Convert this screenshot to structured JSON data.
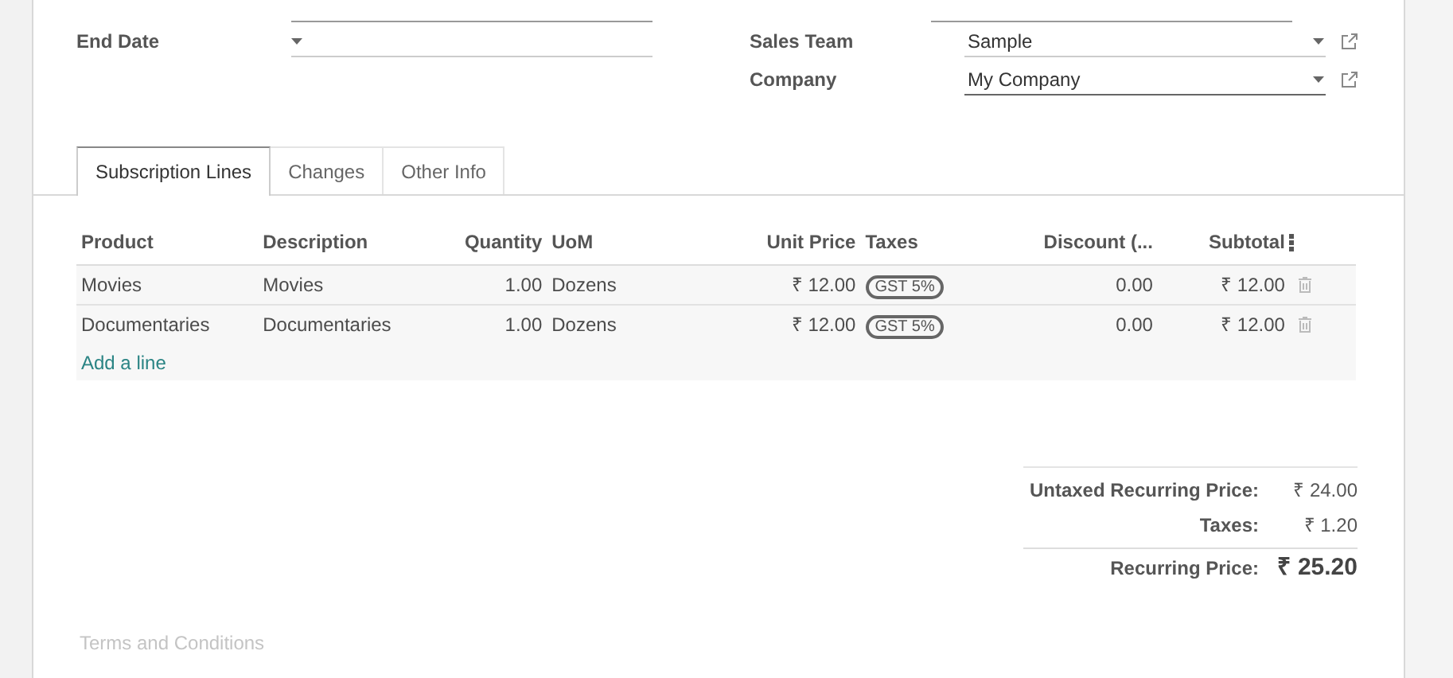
{
  "form": {
    "left_fields": [
      {
        "label": "End Date",
        "kind": "dropdown",
        "focused": false
      }
    ],
    "right_fields": [
      {
        "label": "Sales Team",
        "value": "Sample",
        "focused": false
      },
      {
        "label": "Company",
        "value": "My Company",
        "focused": true
      }
    ]
  },
  "tabs": [
    {
      "label": "Subscription Lines",
      "selected": true
    },
    {
      "label": "Changes",
      "selected": false
    },
    {
      "label": "Other Info",
      "selected": false
    }
  ],
  "table": {
    "columns": [
      "Product",
      "Description",
      "Quantity",
      "UoM",
      "Unit Price",
      "Taxes",
      "Discount (...",
      "Subtotal"
    ],
    "rows": [
      {
        "cells": [
          "Movies",
          "Movies",
          "1.00",
          "Dozens",
          "₹ 12.00",
          "GST 5%",
          "0.00",
          "₹ 12.00"
        ]
      },
      {
        "cells": [
          "Documentaries",
          "Documentaries",
          "1.00",
          "Dozens",
          "₹ 12.00",
          "GST 5%",
          "0.00",
          "₹ 12.00"
        ]
      }
    ],
    "add_line": "Add a line"
  },
  "totals": [
    {
      "label": "Untaxed Recurring Price:",
      "value": "₹ 24.00",
      "kind": "normal"
    },
    {
      "label": "Taxes:",
      "value": "₹ 1.20",
      "kind": "normal"
    },
    {
      "label": "Recurring Price:",
      "value": "₹ 25.20",
      "kind": "grand"
    }
  ],
  "notes": {
    "placeholder": "Terms and Conditions"
  }
}
